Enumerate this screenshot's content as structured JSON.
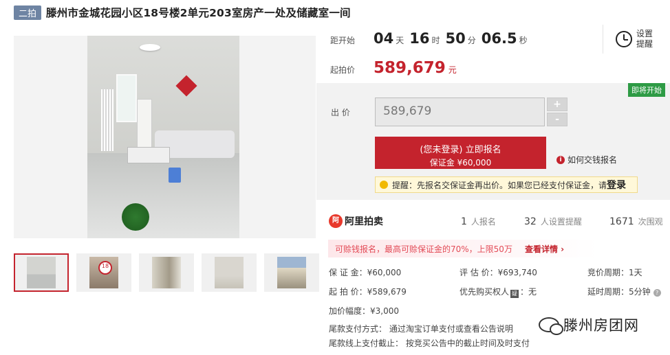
{
  "header": {
    "badge": "二拍",
    "title": "滕州市金城花园小区18号楼2单元203室房产一处及储藏室一间"
  },
  "countdown": {
    "label": "距开始",
    "days": "04",
    "days_unit": "天",
    "hours": "16",
    "hours_unit": "时",
    "minutes": "50",
    "minutes_unit": "分",
    "seconds": "06.5",
    "seconds_unit": "秒"
  },
  "reminder": {
    "label": "设置提醒",
    "icon": "alarm-clock-icon"
  },
  "start_price": {
    "label": "起拍价",
    "value": "589,679",
    "unit": "元"
  },
  "bid": {
    "status_tag": "即将开始",
    "label": "出 价",
    "input_value": "589,679",
    "increase": "+",
    "decrease": "-",
    "signup_main": "(您未登录) 立即报名",
    "signup_sub": "保证金 ¥60,000",
    "how_to_pay": "如何交钱报名",
    "tip_text": "提醒：先报名交保证金再出价。如果您已经支付保证金，请",
    "tip_link": "登录"
  },
  "brand": {
    "name": "阿里拍卖",
    "logo_text": "阿"
  },
  "stats": [
    {
      "value": "1",
      "label": "人报名"
    },
    {
      "value": "32",
      "label": "人设置提醒"
    },
    {
      "value": "1671",
      "label": "次围观"
    }
  ],
  "banner": {
    "text": "可赊钱报名，最高可赊保证金的70%，上限50万",
    "link": "查看详情 ›"
  },
  "details": {
    "deposit": "保 证 金：¥60,000",
    "appraisal": "评 估 价：¥693,740",
    "bid_period": "竞价周期：1天",
    "starting": "起 拍 价：¥589,679",
    "priority_label": "优先购买权人",
    "priority_icon": "疑",
    "priority_value": "：无",
    "delay_period": "延时周期：5分钟",
    "increment": "加价幅度：¥3,000",
    "final_pay_method": "尾款支付方式：  通过淘宝订单支付或查看公告说明",
    "final_pay_deadline": "尾款线上支付截止：  按竞买公告中的截止时间及时支付"
  },
  "watermark": {
    "text": "滕州房团网"
  },
  "colors": {
    "accent": "#c4232d",
    "badge": "#6e84a3",
    "status_green": "#2e9b45"
  }
}
